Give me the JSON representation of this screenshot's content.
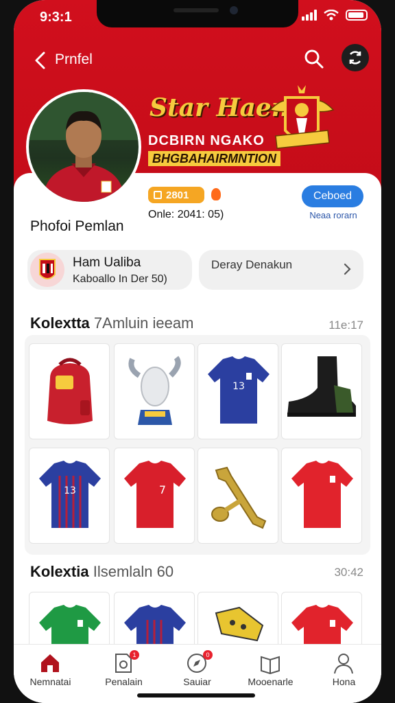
{
  "status": {
    "time": "9:3:1"
  },
  "topbar": {
    "title": "Prnfel"
  },
  "banner": {
    "script": "Star Haen",
    "line2": "DCBIRN NGAKO",
    "line3": "BHGBAHAIRMNTION"
  },
  "profile": {
    "badge_value": "2801",
    "since": "Onle: 2041: 05)",
    "follow_label": "Ceboed",
    "follow_sub": "Neaa rorarn",
    "title": "Phofoi Pemlan"
  },
  "club": {
    "name": "Ham Ualiba",
    "sub": "Kaboallo In Der 50)"
  },
  "action_pill": {
    "label": "Deray Denakun"
  },
  "section1": {
    "title_bold": "Kolextta",
    "title_rest": "7Amluin ieeam",
    "time": "11e:17"
  },
  "section2": {
    "title_bold": "Kolextia",
    "title_rest": "Ilsemlaln 60",
    "time": "30:42"
  },
  "collection1": [
    {
      "item": "red-backpack-icon"
    },
    {
      "item": "trophy-icon"
    },
    {
      "item": "blue-jersey-icon"
    },
    {
      "item": "black-boot-icon"
    },
    {
      "item": "blue-striped-jersey-icon"
    },
    {
      "item": "red-jersey-icon"
    },
    {
      "item": "gold-key-icon"
    },
    {
      "item": "red-jersey-icon"
    }
  ],
  "collection2": [
    {
      "item": "green-jersey-icon"
    },
    {
      "item": "blue-striped-jersey-icon"
    },
    {
      "item": "yellow-boot-icon"
    },
    {
      "item": "red-jersey-icon"
    }
  ],
  "tabs": [
    {
      "label": "Nemnatai",
      "icon": "home-icon",
      "active": true
    },
    {
      "label": "Penalain",
      "icon": "document-icon",
      "badge": "1"
    },
    {
      "label": "Sauiar",
      "icon": "compass-icon",
      "badge": "0"
    },
    {
      "label": "Mooenarle",
      "icon": "book-icon"
    },
    {
      "label": "Hona",
      "icon": "user-icon"
    }
  ],
  "colors": {
    "brand_red": "#d10f1d",
    "accent_blue": "#2a7de1",
    "gold": "#f5a623"
  }
}
